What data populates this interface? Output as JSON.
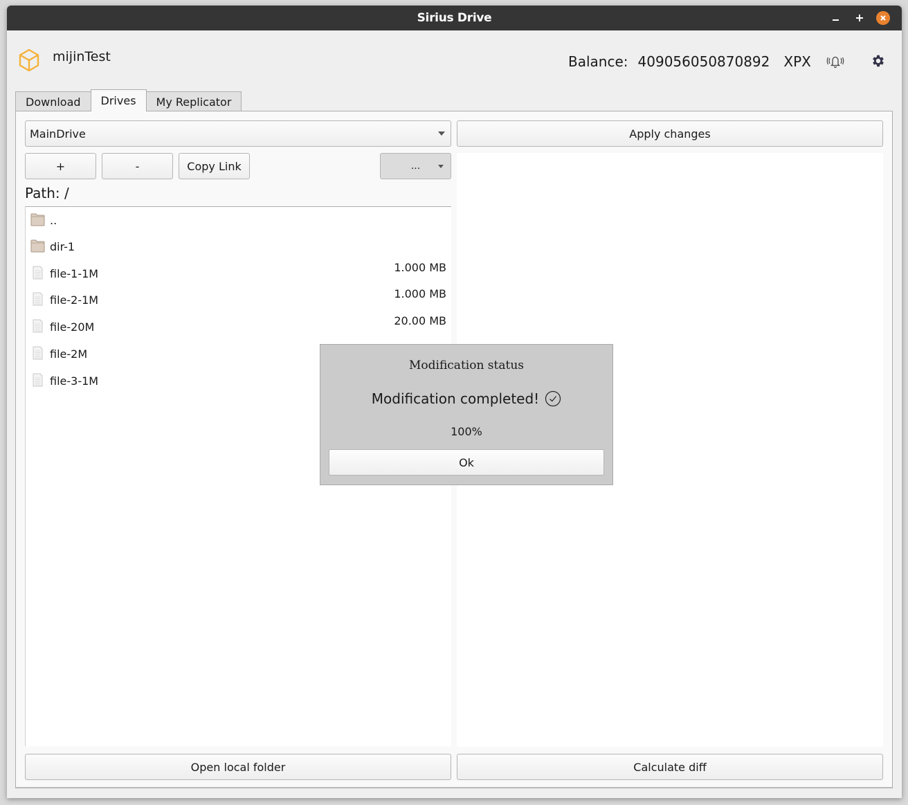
{
  "window": {
    "title": "Sirius Drive",
    "controls": {
      "minimize": "–",
      "maximize": "+",
      "close": "×"
    }
  },
  "header": {
    "account_name": "mijinTest",
    "balance_label": "Balance:",
    "balance_value": "409056050870892",
    "currency": "XPX",
    "icons": [
      "cube-logo-icon",
      "bell-ringing-icon",
      "gear-icon"
    ],
    "accent_color": "#f5b23b"
  },
  "tabs": [
    {
      "label": "Download",
      "active": false
    },
    {
      "label": "Drives",
      "active": true
    },
    {
      "label": "My Replicator",
      "active": false
    }
  ],
  "drives": {
    "selected_drive": "MainDrive",
    "apply_button": "Apply changes",
    "add_button": "+",
    "remove_button": "-",
    "copy_link_button": "Copy Link",
    "more_button": "...",
    "path_label": "Path: /",
    "files": [
      {
        "name": "..",
        "type": "folder",
        "size": ""
      },
      {
        "name": "dir-1",
        "type": "folder",
        "size": ""
      },
      {
        "name": "file-1-1M",
        "type": "file",
        "size": "1.000 MB"
      },
      {
        "name": "file-2-1M",
        "type": "file",
        "size": "1.000 MB"
      },
      {
        "name": "file-20M",
        "type": "file",
        "size": "20.00 MB"
      },
      {
        "name": "file-2M",
        "type": "file",
        "size": ""
      },
      {
        "name": "file-3-1M",
        "type": "file",
        "size": ""
      }
    ],
    "open_local_folder_button": "Open local folder",
    "calculate_diff_button": "Calculate diff"
  },
  "dialog": {
    "title": "Modification status",
    "message": "Modification completed!",
    "progress_text": "100%",
    "progress": 1.0,
    "ok_button": "Ok"
  }
}
